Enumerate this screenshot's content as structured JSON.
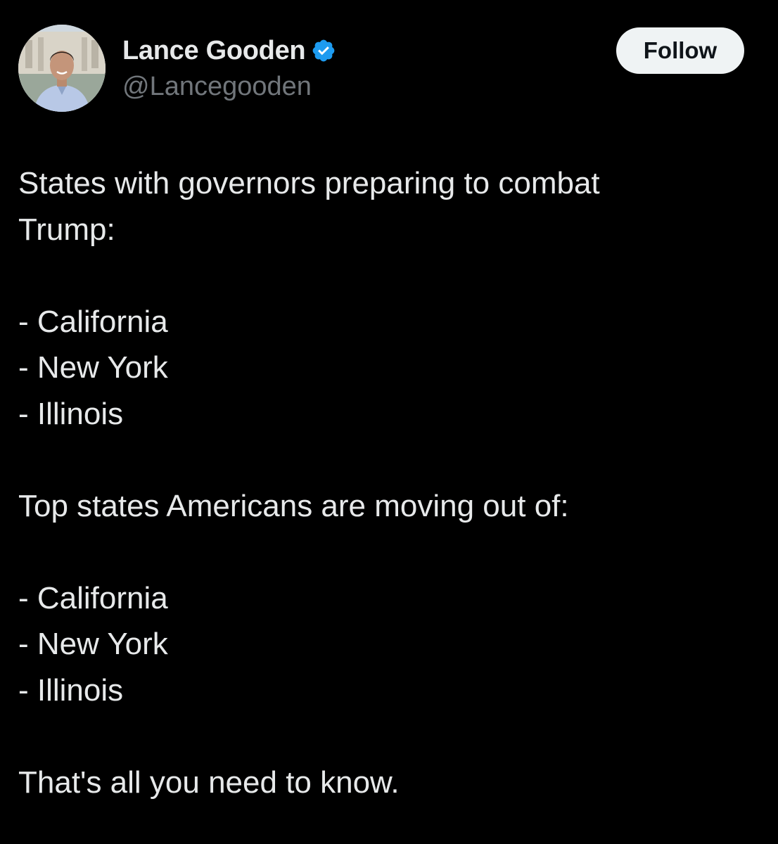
{
  "author": {
    "display_name": "Lance Gooden",
    "handle": "@Lancegooden",
    "verified": true,
    "verified_color": "#1d9bf0",
    "avatar": "profile-photo"
  },
  "actions": {
    "follow_label": "Follow"
  },
  "tweet": {
    "lines": [
      "States with governors preparing to combat",
      "Trump:",
      "",
      "- California",
      "- New York",
      "- Illinois",
      "",
      "Top states Americans are moving out of:",
      "",
      "- California",
      "- New York",
      "- Illinois",
      "",
      "That's all you need to know."
    ]
  },
  "colors": {
    "background": "#000000",
    "text_primary": "#e7e9ea",
    "text_secondary": "#71767b",
    "button_bg": "#eff3f4"
  }
}
